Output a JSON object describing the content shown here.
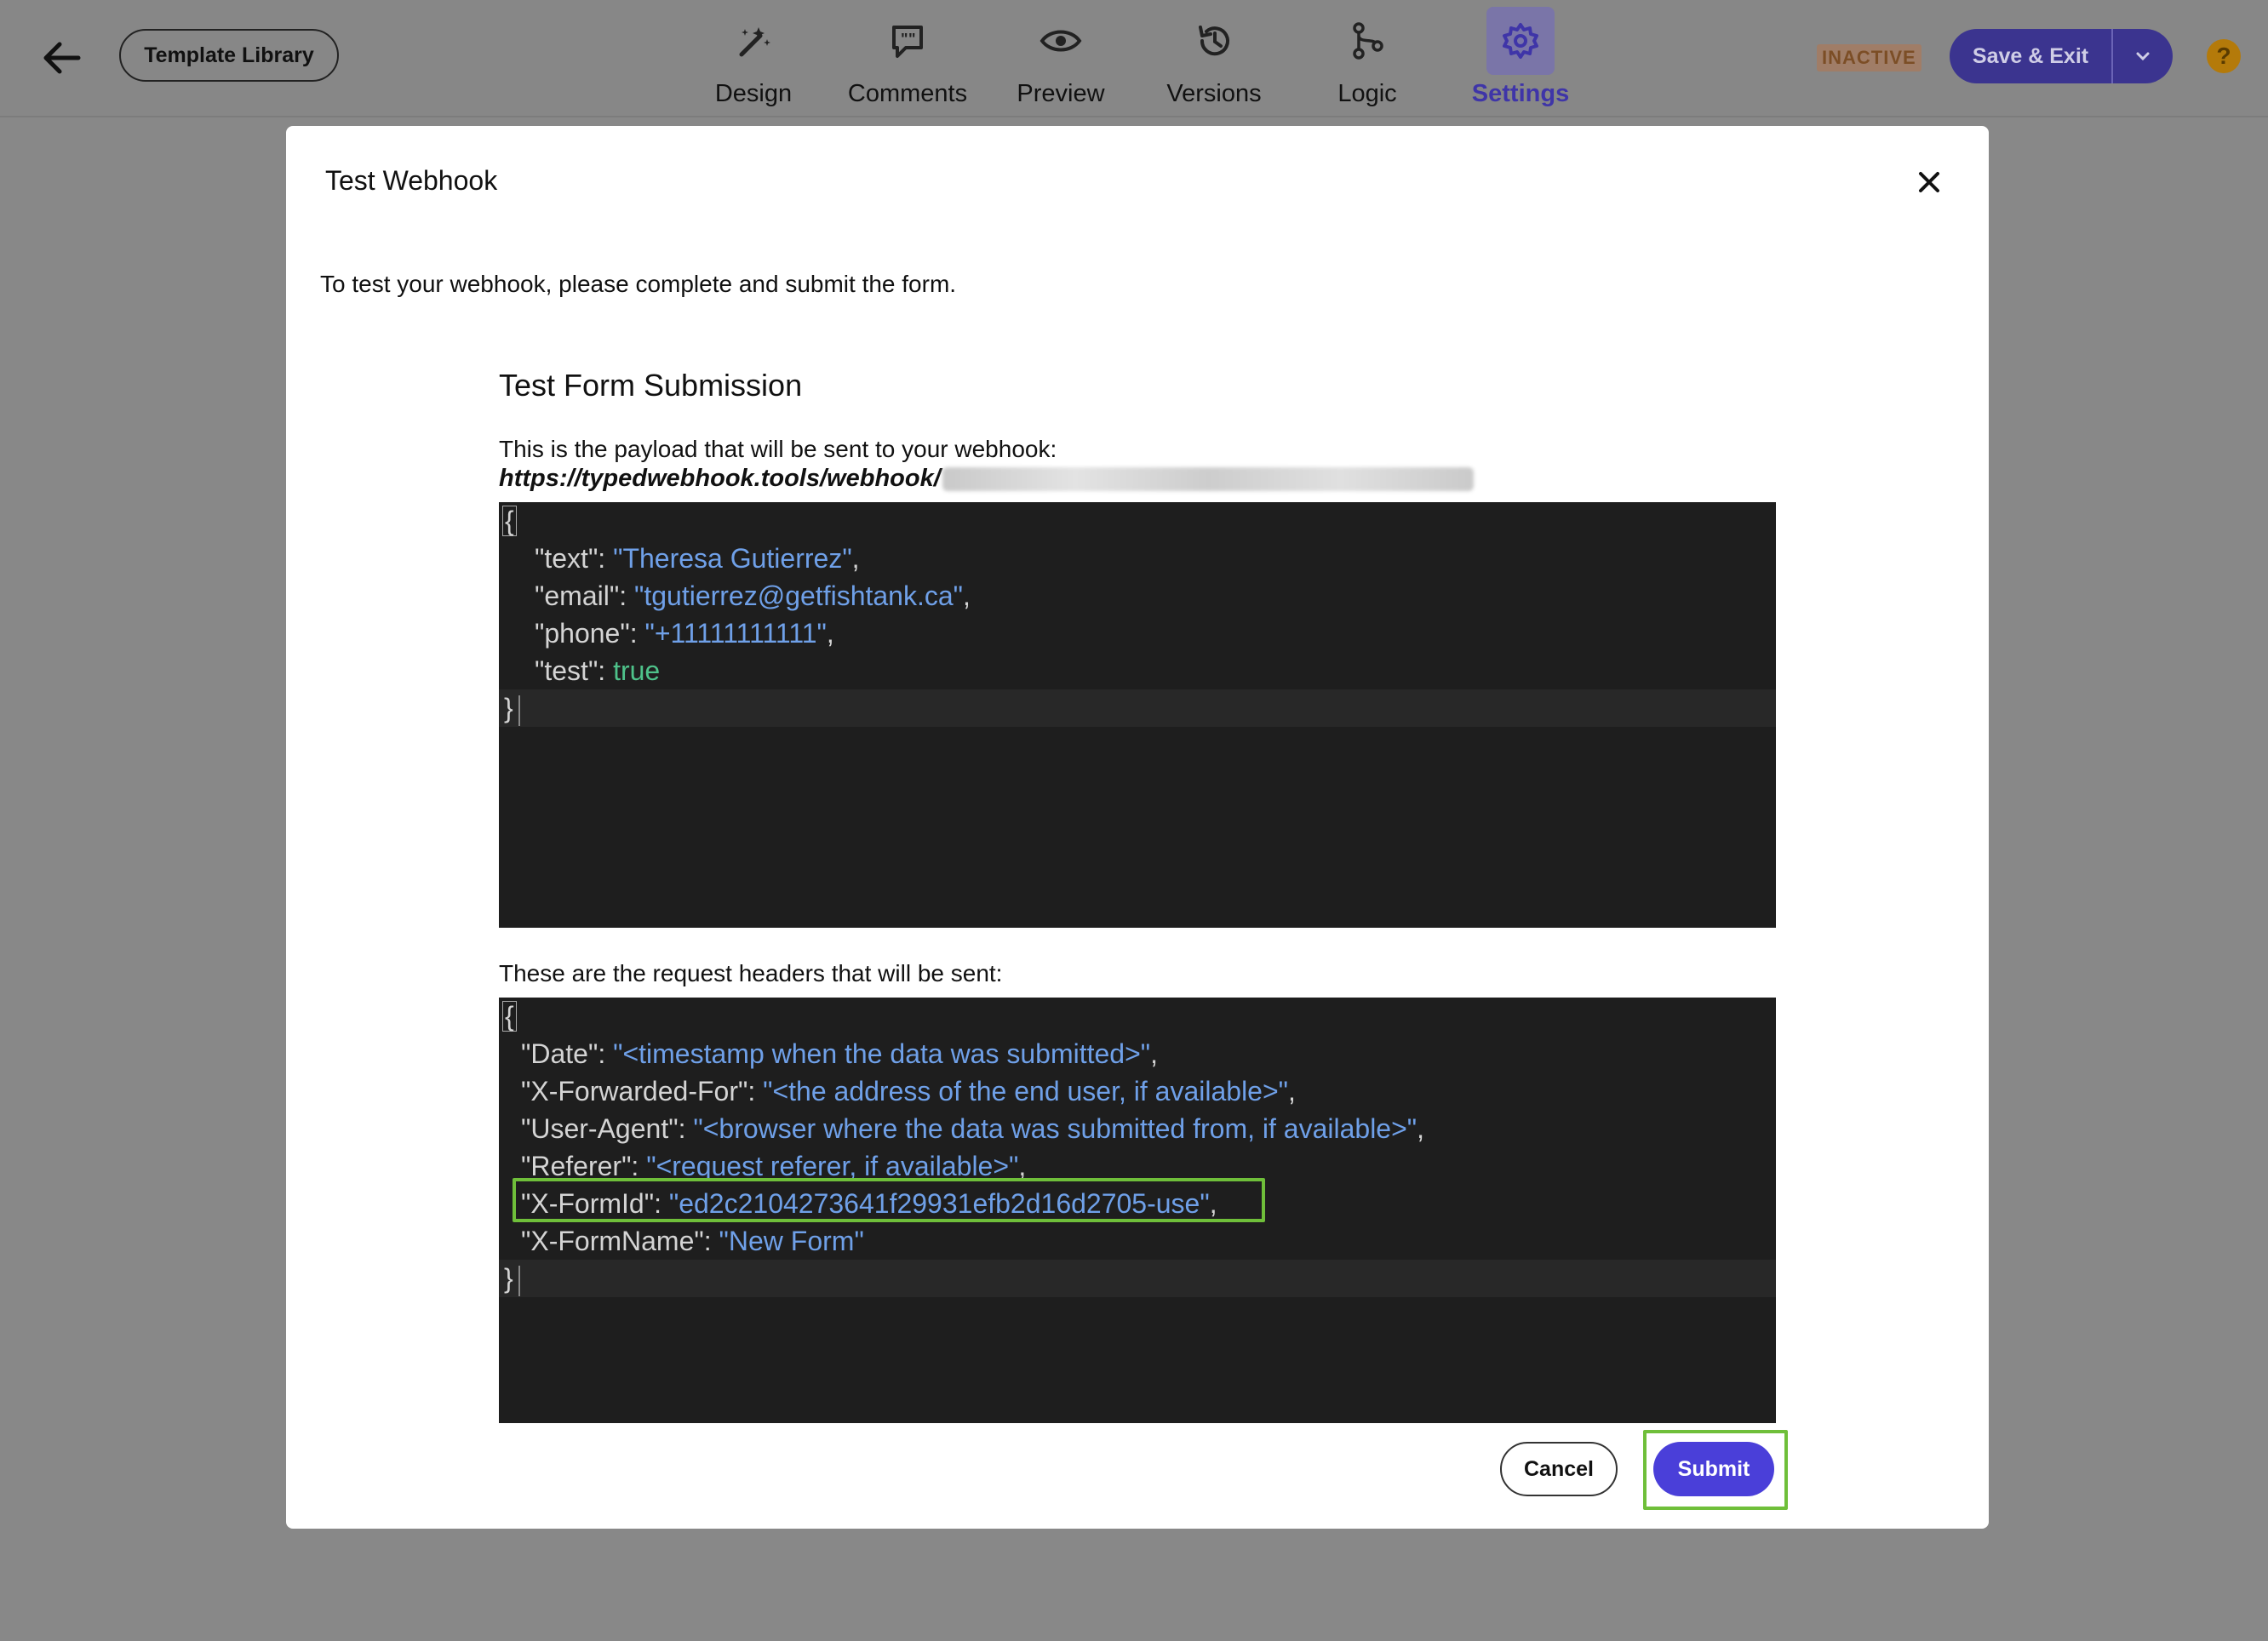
{
  "topbar": {
    "back_icon": "arrow-left-icon",
    "template_library_label": "Template Library",
    "tabs": [
      {
        "label": "Design",
        "icon": "magic-wand-icon",
        "active": false
      },
      {
        "label": "Comments",
        "icon": "comment-icon",
        "active": false
      },
      {
        "label": "Preview",
        "icon": "eye-icon",
        "active": false
      },
      {
        "label": "Versions",
        "icon": "history-icon",
        "active": false
      },
      {
        "label": "Logic",
        "icon": "branch-icon",
        "active": false
      },
      {
        "label": "Settings",
        "icon": "gear-icon",
        "active": true
      }
    ],
    "status_badge": "INACTIVE",
    "save_exit_label": "Save & Exit",
    "help_label": "?"
  },
  "modal": {
    "title": "Test Webhook",
    "intro": "To test your webhook, please complete and submit the form.",
    "section_title": "Test Form Submission",
    "payload_label": "This is the payload that will be sent to your webhook:",
    "payload_url": "https://typedwebhook.tools/webhook/",
    "payload": {
      "open": "{",
      "close": "}",
      "lines": [
        {
          "key": "\"text\"",
          "value": "\"Theresa Gutierrez\"",
          "type": "string",
          "comma": ","
        },
        {
          "key": "\"email\"",
          "value": "\"tgutierrez@getfishtank.ca\"",
          "type": "string",
          "comma": ","
        },
        {
          "key": "\"phone\"",
          "value": "\"+11111111111\"",
          "type": "string",
          "comma": ","
        },
        {
          "key": "\"test\"",
          "value": "true",
          "type": "bool",
          "comma": ""
        }
      ]
    },
    "headers_label": "These are the request headers that will be sent:",
    "headers": {
      "open": "{",
      "close": "}",
      "lines": [
        {
          "key": "\"Date\"",
          "value": "\"<timestamp when the data was submitted>\"",
          "comma": ","
        },
        {
          "key": "\"X-Forwarded-For\"",
          "value": "\"<the address of the end user, if available>\"",
          "comma": ","
        },
        {
          "key": "\"User-Agent\"",
          "value": "\"<browser where the data was submitted from, if available>\"",
          "comma": ","
        },
        {
          "key": "\"Referer\"",
          "value": "\"<request referer, if available>\"",
          "comma": ","
        },
        {
          "key": "\"X-FormId\"",
          "value": "\"ed2c2104273641f29931efb2d16d2705-use\"",
          "comma": ","
        },
        {
          "key": "\"X-FormName\"",
          "value": "\"New Form\"",
          "comma": ""
        }
      ]
    },
    "cancel_label": "Cancel",
    "submit_label": "Submit",
    "colors": {
      "accent": "#4a3fd9",
      "highlight_frame": "#6fbf3a",
      "code_bg": "#1e1e1e",
      "code_string": "#6fa0e8",
      "code_bool": "#4ec28a"
    }
  }
}
